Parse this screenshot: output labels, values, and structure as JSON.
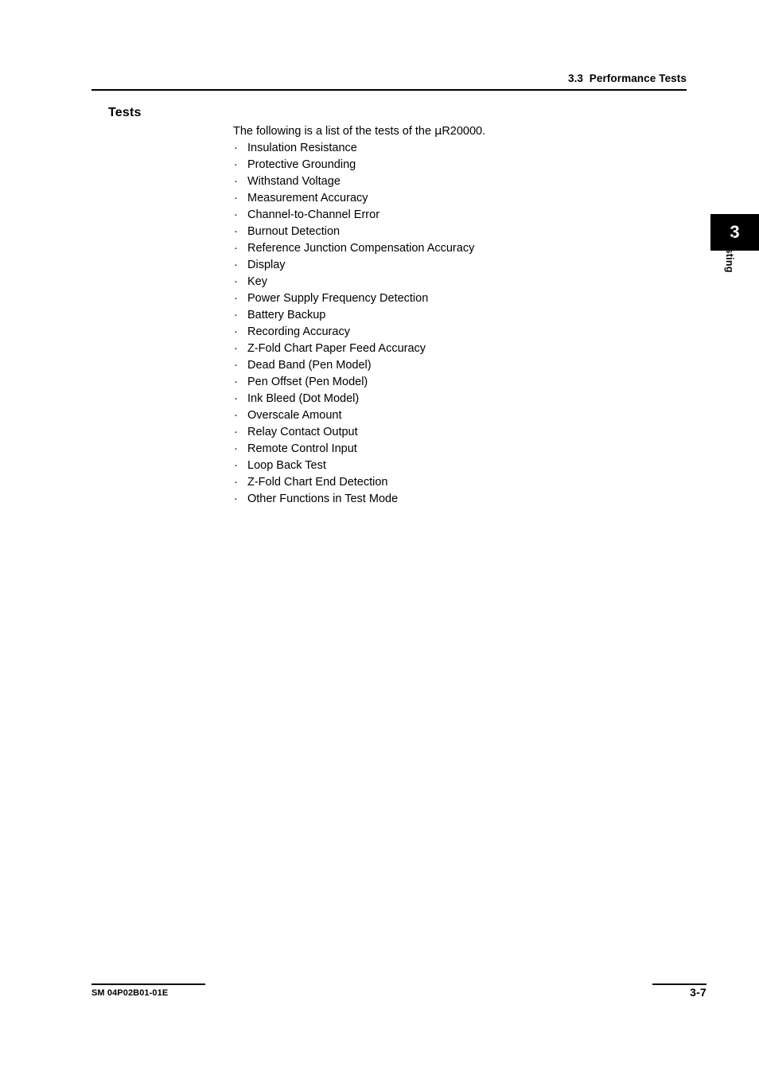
{
  "header": {
    "running_head": "3.3  Performance Tests"
  },
  "section": {
    "heading": "Tests",
    "intro_before_mu": "The following is a list of the tests of the ",
    "mu_symbol": "μ",
    "intro_after_mu": "R20000.",
    "bullet_marker": "·",
    "tests": [
      "Insulation Resistance",
      "Protective Grounding",
      "Withstand Voltage",
      "Measurement Accuracy",
      "Channel-to-Channel Error",
      "Burnout Detection",
      "Reference Junction Compensation Accuracy",
      "Display",
      "Key",
      "Power Supply Frequency Detection",
      "Battery Backup",
      "Recording Accuracy",
      "Z-Fold Chart Paper Feed Accuracy",
      "Dead Band (Pen Model)",
      "Pen Offset (Pen Model)",
      "Ink Bleed (Dot Model)",
      "Overscale Amount",
      "Relay Contact Output",
      "Remote Control Input",
      "Loop Back Test",
      "Z-Fold Chart End Detection",
      "Other Functions in Test Mode"
    ]
  },
  "chapter_tab": {
    "number": "3",
    "label": "Testing",
    "background_color": "#000000",
    "number_color": "#ffffff"
  },
  "footer": {
    "document_code": "SM 04P02B01-01E",
    "page_number": "3-7"
  }
}
